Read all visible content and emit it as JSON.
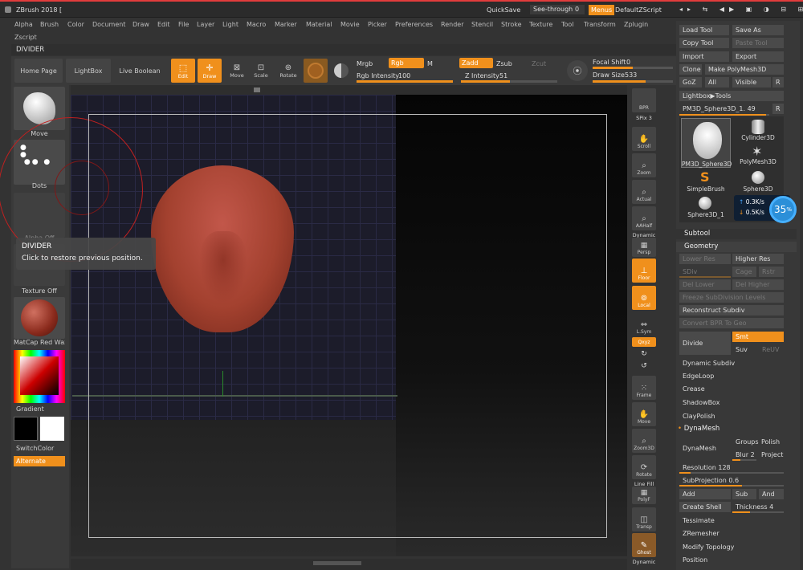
{
  "title": "ZBrush 2018 [",
  "titlebar": {
    "quicksave": "QuickSave",
    "seethrough": "See-through",
    "seethrough_value": "0",
    "menus": "Menus",
    "script": "DefaultZScript"
  },
  "menubar": {
    "items": [
      "Alpha",
      "Brush",
      "Color",
      "Document",
      "Draw",
      "Edit",
      "File",
      "Layer",
      "Light",
      "Macro",
      "Marker",
      "Material",
      "Movie",
      "Picker",
      "Preferences",
      "Render",
      "Stencil",
      "Stroke",
      "Texture",
      "Tool",
      "Transform",
      "Zplugin"
    ],
    "row2": "Zscript"
  },
  "divider_label": "DIVIDER",
  "toolbar": {
    "home": "Home Page",
    "lightbox": "LightBox",
    "liveboolean": "Live Boolean",
    "edit": "Edit",
    "draw": "Draw",
    "move": "Move",
    "scale": "Scale",
    "rotate": "Rotate",
    "mrgb": "Mrgb",
    "rgb": "Rgb",
    "m": "M",
    "zadd": "Zadd",
    "zsub": "Zsub",
    "zcut": "Zcut",
    "rgb_intensity_label": "Rgb Intensity",
    "rgb_intensity": "100",
    "z_intensity_label": "Z Intensity",
    "z_intensity": "51",
    "focal_label": "Focal Shift",
    "focal": "0",
    "drawsize_label": "Draw Size",
    "drawsize": "533"
  },
  "leftshelf": {
    "brush": "Move",
    "stroke": "Dots",
    "alpha": "Alpha Off",
    "texture": "Texture Off",
    "material": "MatCap Red Wax",
    "gradient": "Gradient",
    "switch": "SwitchColor",
    "alternate": "Alternate"
  },
  "tooltip": {
    "title": "DIVIDER",
    "text": "Click to restore previous position."
  },
  "vcol": {
    "bpr": "BPR",
    "spix_label": "SPix",
    "spix": "3",
    "scroll": "Scroll",
    "zoom": "Zoom",
    "actual": "Actual",
    "aahalf": "AAHalf",
    "dynamic": "Dynamic",
    "persp": "Persp",
    "floor": "Floor",
    "local": "Local",
    "lsym": "L.Sym",
    "qxyz": "Qxyz",
    "frame": "Frame",
    "move": "Move",
    "zoom3d": "Zoom3D",
    "rotate": "Rotate",
    "linefill": "Line Fill",
    "polyf": "PolyF",
    "transp": "Transp",
    "ghost": "Ghost",
    "dynamic2": "Dynamic"
  },
  "rpanel": {
    "load": "Load Tool",
    "saveas": "Save As",
    "copy": "Copy Tool",
    "paste": "Paste Tool",
    "import": "Import",
    "export": "Export",
    "clone": "Clone",
    "makepoly": "Make PolyMesh3D",
    "goz": "GoZ",
    "all": "All",
    "visible": "Visible",
    "r": "R",
    "lightbox_tools": "Lightbox▶Tools",
    "current_tool": "PM3D_Sphere3D_1. 49",
    "r2": "R",
    "thumbs": [
      "PM3D_Sphere3D",
      "Cylinder3D",
      "PolyMesh3D",
      "SimpleBrush",
      "Sphere3D",
      "Sphere3D_1"
    ],
    "net_up": "0.3K/s",
    "net_down": "0.5K/s",
    "net_pct": "35",
    "subtool": "Subtool",
    "geometry": "Geometry",
    "lowerres": "Lower Res",
    "higherres": "Higher Res",
    "sdiv": "SDiv",
    "cage": "Cage",
    "rstr": "Rstr",
    "dellower": "Del Lower",
    "delhigher": "Del Higher",
    "freeze": "Freeze SubDivision Levels",
    "reconstruct": "Reconstruct Subdiv",
    "convertbpr": "Convert BPR To Geo",
    "divide": "Divide",
    "smt": "Smt",
    "suv": "Suv",
    "reuv": "ReUV",
    "dynsub": "Dynamic Subdiv",
    "edgeloop": "EdgeLoop",
    "crease": "Crease",
    "shadowbox": "ShadowBox",
    "claypolish": "ClayPolish",
    "dynamesh_hdr": "DynaMesh",
    "dynamesh": "DynaMesh",
    "groups": "Groups",
    "polish": "Polish",
    "blur": "Blur",
    "blur_value": "2",
    "project": "Project",
    "res_label": "Resolution",
    "res": "128",
    "subproj_label": "SubProjection",
    "subproj": "0.6",
    "add": "Add",
    "sub": "Sub",
    "and": "And",
    "createshell": "Create Shell",
    "thick_label": "Thickness",
    "thick": "4",
    "tessimate": "Tessimate",
    "zremesher": "ZRemesher",
    "modtopo": "Modify Topology",
    "position": "Position"
  }
}
